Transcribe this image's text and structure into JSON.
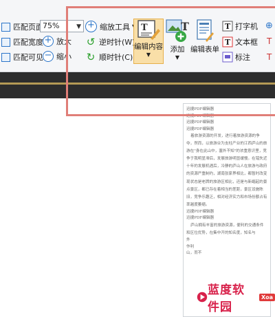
{
  "toolbar": {
    "fit_page": "匹配页面",
    "fit_width": "匹配宽度",
    "fit_visible": "匹配可见",
    "zoom_value": "75%",
    "zoom_in": "放大",
    "zoom_out": "缩小",
    "zoom_tool": "缩放工具",
    "rotate_ccw": "逆时针(W)",
    "rotate_cw": "顺时针(C)",
    "edit_content": "编辑内容",
    "add": "添加",
    "edit_form": "编辑表单",
    "typewriter": "打字机",
    "textbox": "文本框",
    "annotate": "标注"
  },
  "document": {
    "lines": [
      "迅捷PDF编辑器",
      "迅捷PDF编辑器",
      "迅捷PDF编辑器",
      "迅捷PDF编辑器"
    ],
    "paragraph1": "着旅游资源的开发，进行着旅游资源的争夺，然而，以旅游业为支柱产业的江西庐山的旅游在\"身在此山中，塞外不知\"的浓重意识里，竞争于我明显滞后，发展旅游明显缓慢。在错失近十年的发展机遇后，冷静的庐山人在旅游与政府的资源严重制约，湖南张家界相比，都暂时改变现状态是老牌的旅游区相比，还是与新崛起的景点景区，都已存在着相当的差距，景区设施陈旧，竞争乐趣乏，相对经济实力和市场份额占有率越度萎缩。",
    "lines2": [
      "迅捷PDF编辑器",
      "迅捷PDF编辑器"
    ],
    "paragraph2": "庐山拥有丰富的旅游资源，便利的交通条件和区位优势，在集中开的知名度，知名与",
    "tail_lines": [
      "外",
      "作利",
      "山，而不"
    ]
  },
  "watermark": {
    "text": "蓝度软件园",
    "badge": "Xoa"
  },
  "colors": {
    "highlight": "#e07e78",
    "accent_blue": "#2a74c9",
    "active_tool_bg": "#f9dfa8"
  }
}
